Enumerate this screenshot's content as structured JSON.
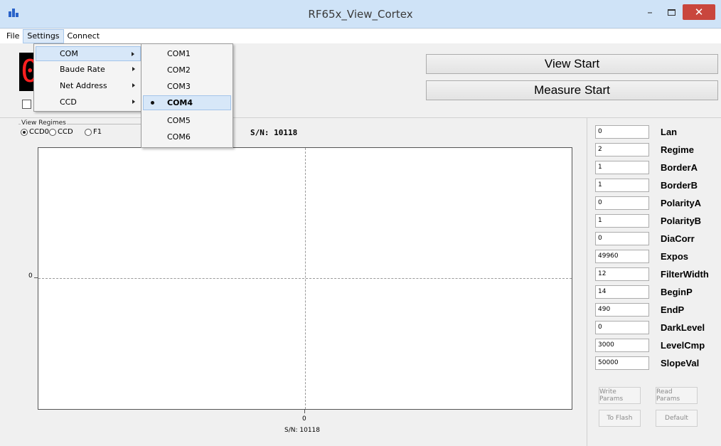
{
  "window": {
    "title": "RF65x_View_Cortex",
    "minimize_glyph": "–",
    "close_glyph": "✕"
  },
  "menubar": {
    "items": [
      "File",
      "Settings",
      "Connect"
    ]
  },
  "settings_menu": {
    "items": [
      "COM",
      "Baude Rate",
      "Net Address",
      "CCD"
    ]
  },
  "com_submenu": {
    "items": [
      "COM1",
      "COM2",
      "COM3",
      "COM4",
      "COM5",
      "COM6"
    ],
    "selected": "COM4"
  },
  "display": {
    "value": "0"
  },
  "buttons": {
    "view_start": "View Start",
    "measure_start": "Measure Start"
  },
  "regimes": {
    "legend": "View Regimes",
    "options": [
      "CCD0",
      "CCD",
      "F1"
    ],
    "selected": "CCD0"
  },
  "plot": {
    "sn_top": "S/N: 10118",
    "sn_bottom": "S/N: 10118",
    "y_zero": "0",
    "x_zero": "0"
  },
  "params": [
    {
      "value": "0",
      "label": "Lan"
    },
    {
      "value": "2",
      "label": "Regime"
    },
    {
      "value": "1",
      "label": "BorderA"
    },
    {
      "value": "1",
      "label": "BorderB"
    },
    {
      "value": "0",
      "label": "PolarityA"
    },
    {
      "value": "1",
      "label": "PolarityB"
    },
    {
      "value": "0",
      "label": "DiaCorr"
    },
    {
      "value": "49960",
      "label": "Expos"
    },
    {
      "value": "12",
      "label": "FilterWidth"
    },
    {
      "value": "14",
      "label": "BeginP"
    },
    {
      "value": "490",
      "label": "EndP"
    },
    {
      "value": "0",
      "label": "DarkLevel"
    },
    {
      "value": "3000",
      "label": "LevelCmp"
    },
    {
      "value": "50000",
      "label": "SlopeVal"
    }
  ],
  "side_buttons": {
    "write_params": "Write Params",
    "read_params": "Read Params",
    "to_flash": "To Flash",
    "default": "Default"
  }
}
